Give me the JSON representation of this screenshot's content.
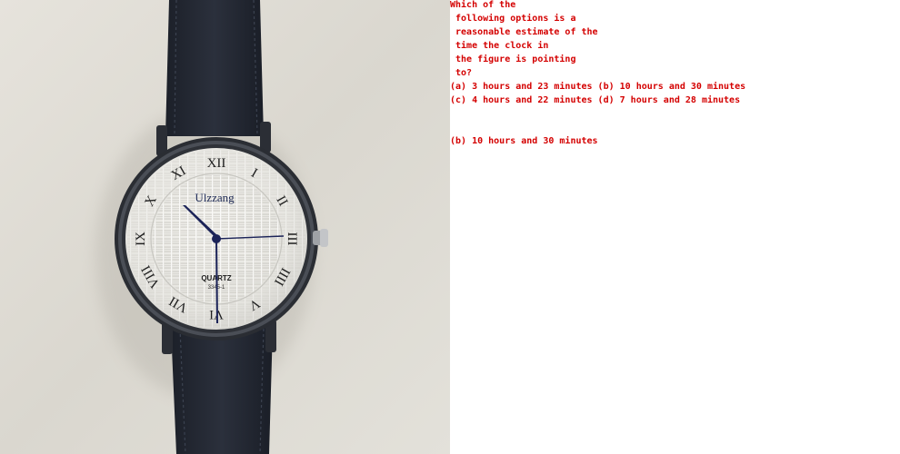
{
  "photo": {
    "subject": "wristwatch",
    "brand": "Ulzzang",
    "movement_label": "QUARTZ",
    "model_label": "3345-1",
    "hour_numerals": [
      "XII",
      "I",
      "II",
      "III",
      "IIII",
      "V",
      "VI",
      "VII",
      "VIII",
      "IX",
      "X",
      "XI"
    ],
    "colors": {
      "background_wall": "#dedbd3",
      "strap": "#232833",
      "case": "#2a2d33",
      "dial": "#e9e8e3",
      "hands": "#1b2358",
      "numerals": "#202020"
    }
  },
  "question": {
    "lines": [
      "Which of the",
      " following options is a",
      " reasonable estimate of the",
      " time the clock in",
      " the figure is pointing",
      " to?"
    ],
    "options": [
      "(a) 3 hours and 23 minutes (b) 10 hours and 30 minutes",
      "(c) 4 hours and 22 minutes (d) 7 hours and 28 minutes"
    ],
    "answer": "(b) 10 hours and 30 minutes",
    "text_color": "#d40000"
  }
}
